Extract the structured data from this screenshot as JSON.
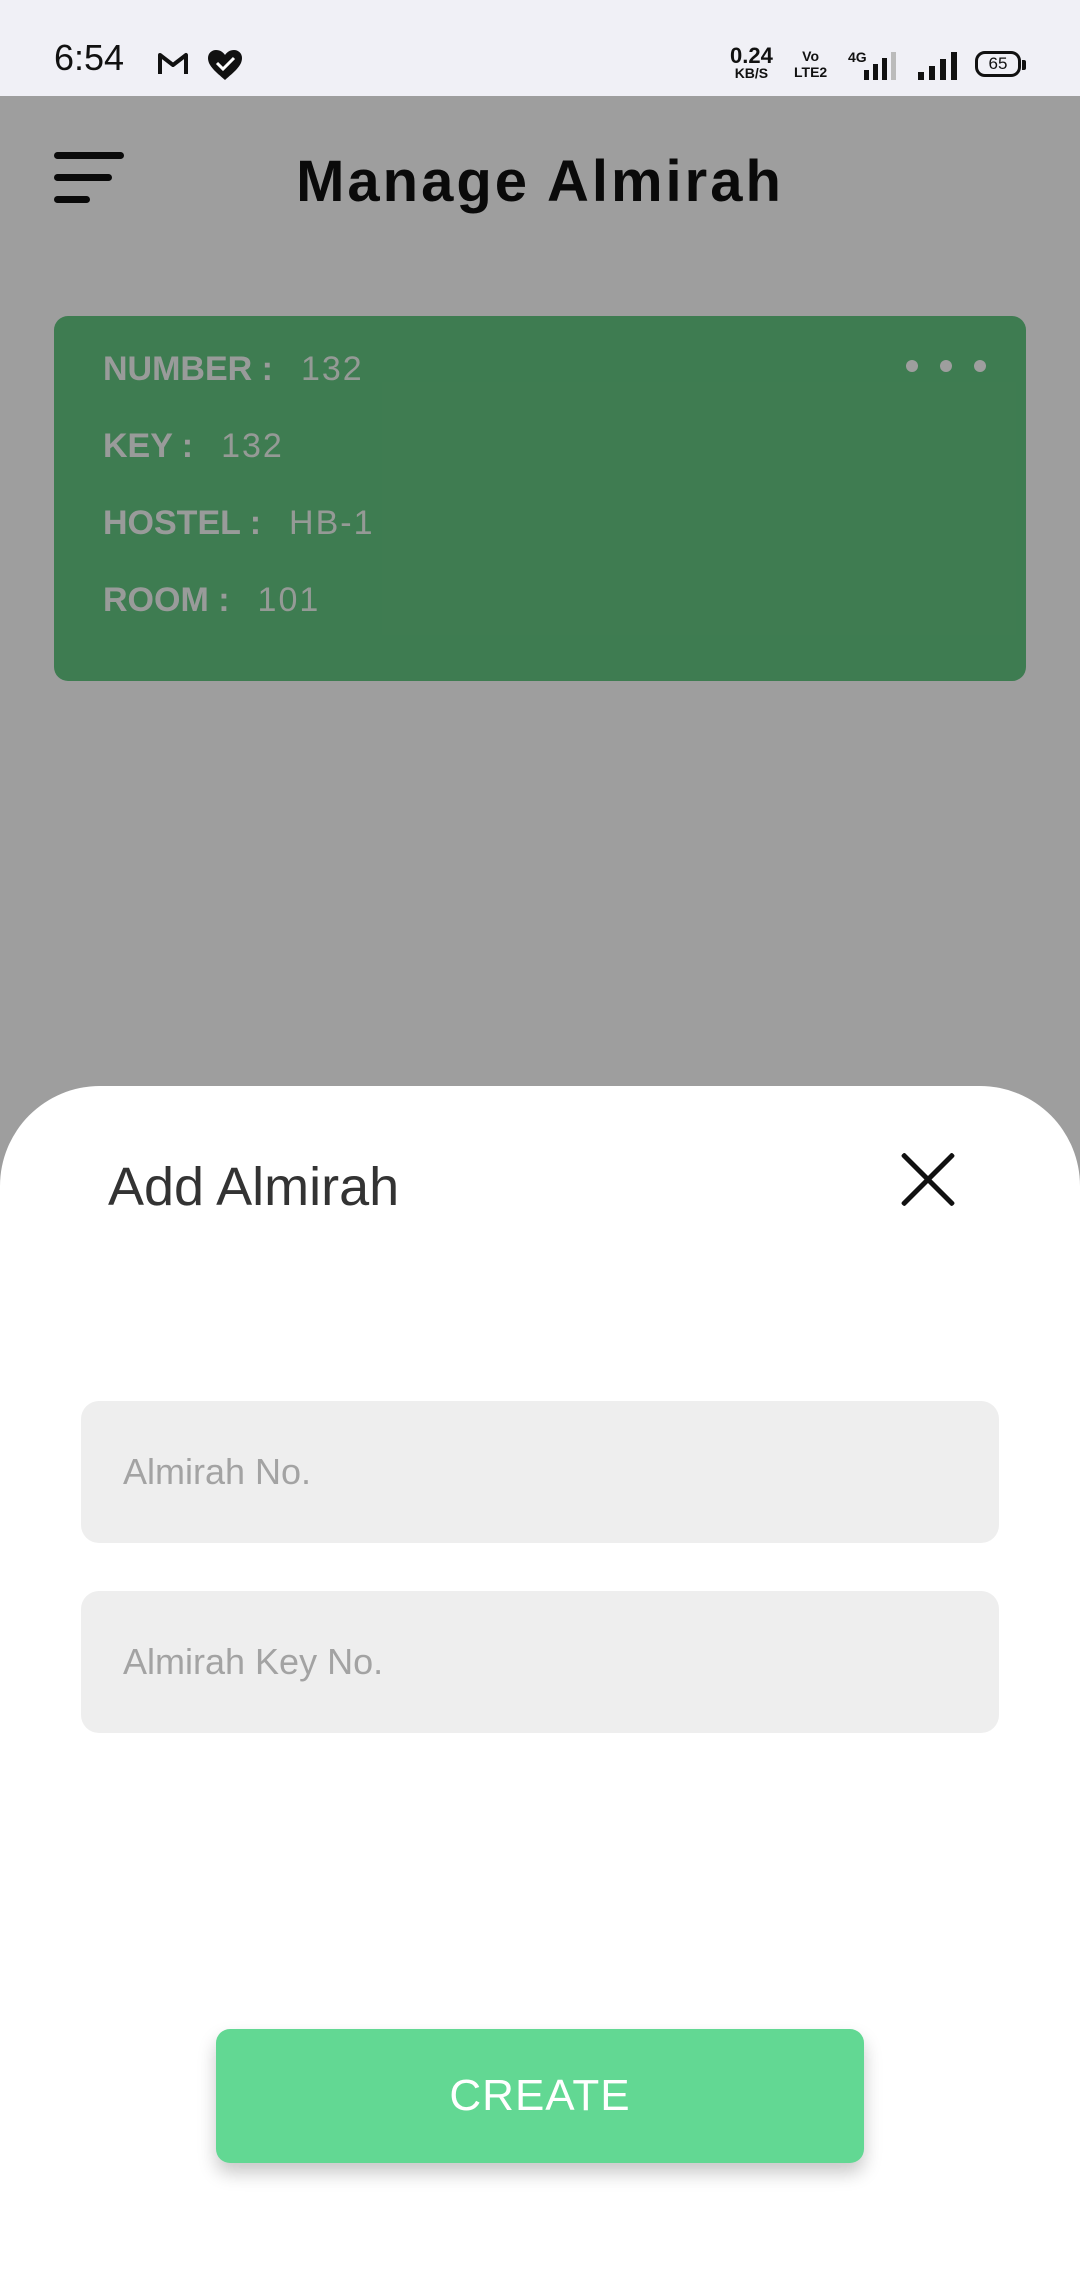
{
  "status_bar": {
    "time": "6:54",
    "net_speed_value": "0.24",
    "net_speed_unit": "KB/S",
    "volte_top": "Vo",
    "volte_bottom": "LTE2",
    "network_type": "4G",
    "battery": "65",
    "icons": [
      "gmail-icon",
      "heart-check-icon",
      "signal-4g-icon",
      "signal-icon",
      "battery-icon"
    ]
  },
  "header": {
    "title": "Manage Almirah"
  },
  "card": {
    "rows": [
      {
        "key": "NUMBER :",
        "value": "132"
      },
      {
        "key": "KEY :",
        "value": "132"
      },
      {
        "key": "HOSTEL :",
        "value": "HB-1"
      },
      {
        "key": "ROOM :",
        "value": "101"
      }
    ],
    "color": "#65c883"
  },
  "sheet": {
    "title": "Add Almirah",
    "almirah_no_placeholder": "Almirah No.",
    "almirah_no_value": "",
    "key_no_placeholder": "Almirah Key No.",
    "key_no_value": "",
    "create_label": "CREATE",
    "accent": "#62d893"
  }
}
